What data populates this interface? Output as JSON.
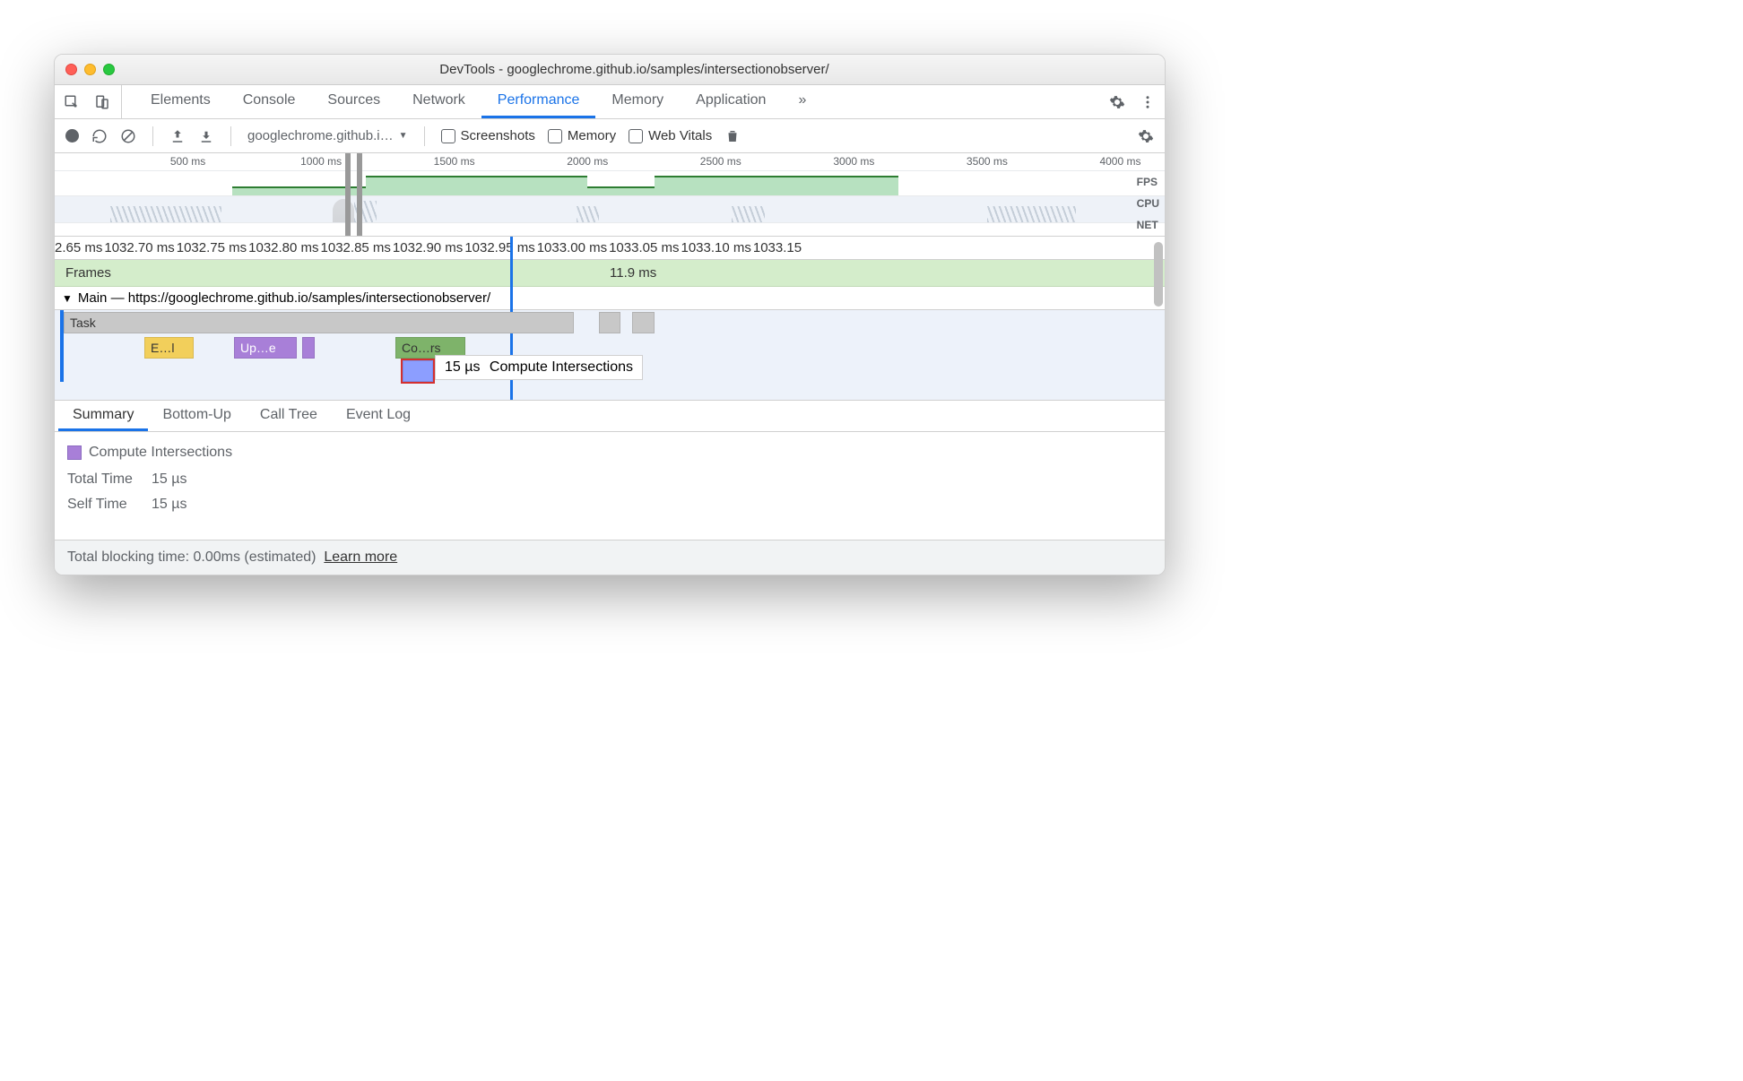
{
  "window": {
    "title": "DevTools - googlechrome.github.io/samples/intersectionobserver/"
  },
  "main_tabs": {
    "items": [
      "Elements",
      "Console",
      "Sources",
      "Network",
      "Performance",
      "Memory",
      "Application"
    ],
    "active": "Performance",
    "more_label": "»"
  },
  "toolbar": {
    "url_dropdown": "googlechrome.github.i…",
    "screenshots_label": "Screenshots",
    "memory_label": "Memory",
    "webvitals_label": "Web Vitals"
  },
  "overview": {
    "ticks": [
      "500 ms",
      "1000 ms",
      "1500 ms",
      "2000 ms",
      "2500 ms",
      "3000 ms",
      "3500 ms",
      "4000 ms"
    ],
    "labels": {
      "fps": "FPS",
      "cpu": "CPU",
      "net": "NET"
    }
  },
  "detail_timeline": {
    "ruler": [
      "2.65 ms",
      "1032.70 ms",
      "1032.75 ms",
      "1032.80 ms",
      "1032.85 ms",
      "1032.90 ms",
      "1032.95 ms",
      "1033.00 ms",
      "1033.05 ms",
      "1033.10 ms",
      "1033.15"
    ],
    "frames_label": "Frames",
    "frames_time": "11.9 ms",
    "main_label": "Main — https://googlechrome.github.io/samples/intersectionobserver/",
    "events": {
      "task": "Task",
      "e1": "E…l",
      "e2": "Up…e",
      "e3": "Co…rs"
    },
    "tooltip": {
      "duration": "15 µs",
      "name": "Compute Intersections"
    },
    "cursor_x_pct": 41
  },
  "bottom_tabs": {
    "items": [
      "Summary",
      "Bottom-Up",
      "Call Tree",
      "Event Log"
    ],
    "active": "Summary"
  },
  "summary": {
    "event_name": "Compute Intersections",
    "rows": [
      {
        "label": "Total Time",
        "value": "15 µs"
      },
      {
        "label": "Self Time",
        "value": "15 µs"
      }
    ]
  },
  "footer": {
    "text": "Total blocking time: 0.00ms (estimated)",
    "link": "Learn more"
  }
}
